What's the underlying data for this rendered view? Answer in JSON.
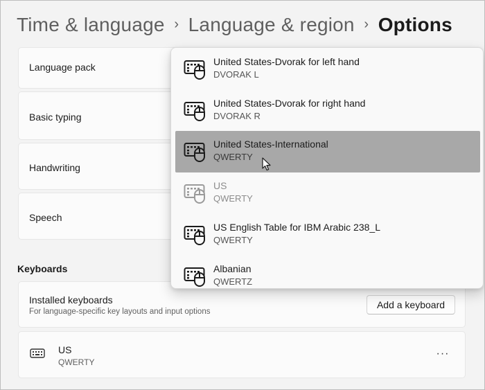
{
  "breadcrumb": {
    "items": [
      "Time & language",
      "Language & region",
      "Options"
    ],
    "separator": "›"
  },
  "cards": [
    {
      "label": "Language pack"
    },
    {
      "label": "Basic typing"
    },
    {
      "label": "Handwriting"
    },
    {
      "label": "Speech"
    }
  ],
  "keyboards": {
    "section_title": "Keyboards",
    "installed": {
      "title": "Installed keyboards",
      "subtitle": "For language-specific key layouts and input options",
      "add_button": "Add a keyboard"
    },
    "current": {
      "name": "US",
      "layout": "QWERTY",
      "icon": "keyboard-icon",
      "more": "···"
    }
  },
  "dropdown": {
    "items": [
      {
        "name": "United States-Dvorak for left hand",
        "layout": "DVORAK L",
        "state": "normal"
      },
      {
        "name": "United States-Dvorak for right hand",
        "layout": "DVORAK R",
        "state": "normal"
      },
      {
        "name": "United States-International",
        "layout": "QWERTY",
        "state": "selected"
      },
      {
        "name": "US",
        "layout": "QWERTY",
        "state": "disabled"
      },
      {
        "name": "US English Table for IBM Arabic 238_L",
        "layout": "QWERTY",
        "state": "normal"
      },
      {
        "name": "Albanian",
        "layout": "QWERTZ",
        "state": "normal"
      }
    ],
    "icon": "keyboard-mouse-icon"
  },
  "colors": {
    "background": "#f3f3f3",
    "card": "#fbfbfb",
    "selected": "#a8a8a8",
    "muted_text": "#5f5f5f"
  }
}
